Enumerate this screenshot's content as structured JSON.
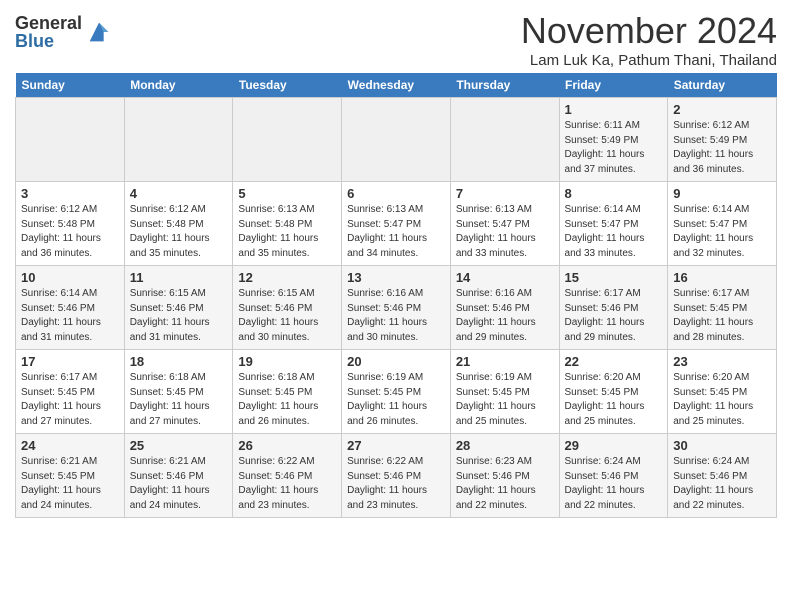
{
  "logo": {
    "general": "General",
    "blue": "Blue"
  },
  "title": "November 2024",
  "location": "Lam Luk Ka, Pathum Thani, Thailand",
  "weekdays": [
    "Sunday",
    "Monday",
    "Tuesday",
    "Wednesday",
    "Thursday",
    "Friday",
    "Saturday"
  ],
  "weeks": [
    [
      {
        "day": "",
        "info": ""
      },
      {
        "day": "",
        "info": ""
      },
      {
        "day": "",
        "info": ""
      },
      {
        "day": "",
        "info": ""
      },
      {
        "day": "",
        "info": ""
      },
      {
        "day": "1",
        "info": "Sunrise: 6:11 AM\nSunset: 5:49 PM\nDaylight: 11 hours\nand 37 minutes."
      },
      {
        "day": "2",
        "info": "Sunrise: 6:12 AM\nSunset: 5:49 PM\nDaylight: 11 hours\nand 36 minutes."
      }
    ],
    [
      {
        "day": "3",
        "info": "Sunrise: 6:12 AM\nSunset: 5:48 PM\nDaylight: 11 hours\nand 36 minutes."
      },
      {
        "day": "4",
        "info": "Sunrise: 6:12 AM\nSunset: 5:48 PM\nDaylight: 11 hours\nand 35 minutes."
      },
      {
        "day": "5",
        "info": "Sunrise: 6:13 AM\nSunset: 5:48 PM\nDaylight: 11 hours\nand 35 minutes."
      },
      {
        "day": "6",
        "info": "Sunrise: 6:13 AM\nSunset: 5:47 PM\nDaylight: 11 hours\nand 34 minutes."
      },
      {
        "day": "7",
        "info": "Sunrise: 6:13 AM\nSunset: 5:47 PM\nDaylight: 11 hours\nand 33 minutes."
      },
      {
        "day": "8",
        "info": "Sunrise: 6:14 AM\nSunset: 5:47 PM\nDaylight: 11 hours\nand 33 minutes."
      },
      {
        "day": "9",
        "info": "Sunrise: 6:14 AM\nSunset: 5:47 PM\nDaylight: 11 hours\nand 32 minutes."
      }
    ],
    [
      {
        "day": "10",
        "info": "Sunrise: 6:14 AM\nSunset: 5:46 PM\nDaylight: 11 hours\nand 31 minutes."
      },
      {
        "day": "11",
        "info": "Sunrise: 6:15 AM\nSunset: 5:46 PM\nDaylight: 11 hours\nand 31 minutes."
      },
      {
        "day": "12",
        "info": "Sunrise: 6:15 AM\nSunset: 5:46 PM\nDaylight: 11 hours\nand 30 minutes."
      },
      {
        "day": "13",
        "info": "Sunrise: 6:16 AM\nSunset: 5:46 PM\nDaylight: 11 hours\nand 30 minutes."
      },
      {
        "day": "14",
        "info": "Sunrise: 6:16 AM\nSunset: 5:46 PM\nDaylight: 11 hours\nand 29 minutes."
      },
      {
        "day": "15",
        "info": "Sunrise: 6:17 AM\nSunset: 5:46 PM\nDaylight: 11 hours\nand 29 minutes."
      },
      {
        "day": "16",
        "info": "Sunrise: 6:17 AM\nSunset: 5:45 PM\nDaylight: 11 hours\nand 28 minutes."
      }
    ],
    [
      {
        "day": "17",
        "info": "Sunrise: 6:17 AM\nSunset: 5:45 PM\nDaylight: 11 hours\nand 27 minutes."
      },
      {
        "day": "18",
        "info": "Sunrise: 6:18 AM\nSunset: 5:45 PM\nDaylight: 11 hours\nand 27 minutes."
      },
      {
        "day": "19",
        "info": "Sunrise: 6:18 AM\nSunset: 5:45 PM\nDaylight: 11 hours\nand 26 minutes."
      },
      {
        "day": "20",
        "info": "Sunrise: 6:19 AM\nSunset: 5:45 PM\nDaylight: 11 hours\nand 26 minutes."
      },
      {
        "day": "21",
        "info": "Sunrise: 6:19 AM\nSunset: 5:45 PM\nDaylight: 11 hours\nand 25 minutes."
      },
      {
        "day": "22",
        "info": "Sunrise: 6:20 AM\nSunset: 5:45 PM\nDaylight: 11 hours\nand 25 minutes."
      },
      {
        "day": "23",
        "info": "Sunrise: 6:20 AM\nSunset: 5:45 PM\nDaylight: 11 hours\nand 25 minutes."
      }
    ],
    [
      {
        "day": "24",
        "info": "Sunrise: 6:21 AM\nSunset: 5:45 PM\nDaylight: 11 hours\nand 24 minutes."
      },
      {
        "day": "25",
        "info": "Sunrise: 6:21 AM\nSunset: 5:46 PM\nDaylight: 11 hours\nand 24 minutes."
      },
      {
        "day": "26",
        "info": "Sunrise: 6:22 AM\nSunset: 5:46 PM\nDaylight: 11 hours\nand 23 minutes."
      },
      {
        "day": "27",
        "info": "Sunrise: 6:22 AM\nSunset: 5:46 PM\nDaylight: 11 hours\nand 23 minutes."
      },
      {
        "day": "28",
        "info": "Sunrise: 6:23 AM\nSunset: 5:46 PM\nDaylight: 11 hours\nand 22 minutes."
      },
      {
        "day": "29",
        "info": "Sunrise: 6:24 AM\nSunset: 5:46 PM\nDaylight: 11 hours\nand 22 minutes."
      },
      {
        "day": "30",
        "info": "Sunrise: 6:24 AM\nSunset: 5:46 PM\nDaylight: 11 hours\nand 22 minutes."
      }
    ]
  ]
}
